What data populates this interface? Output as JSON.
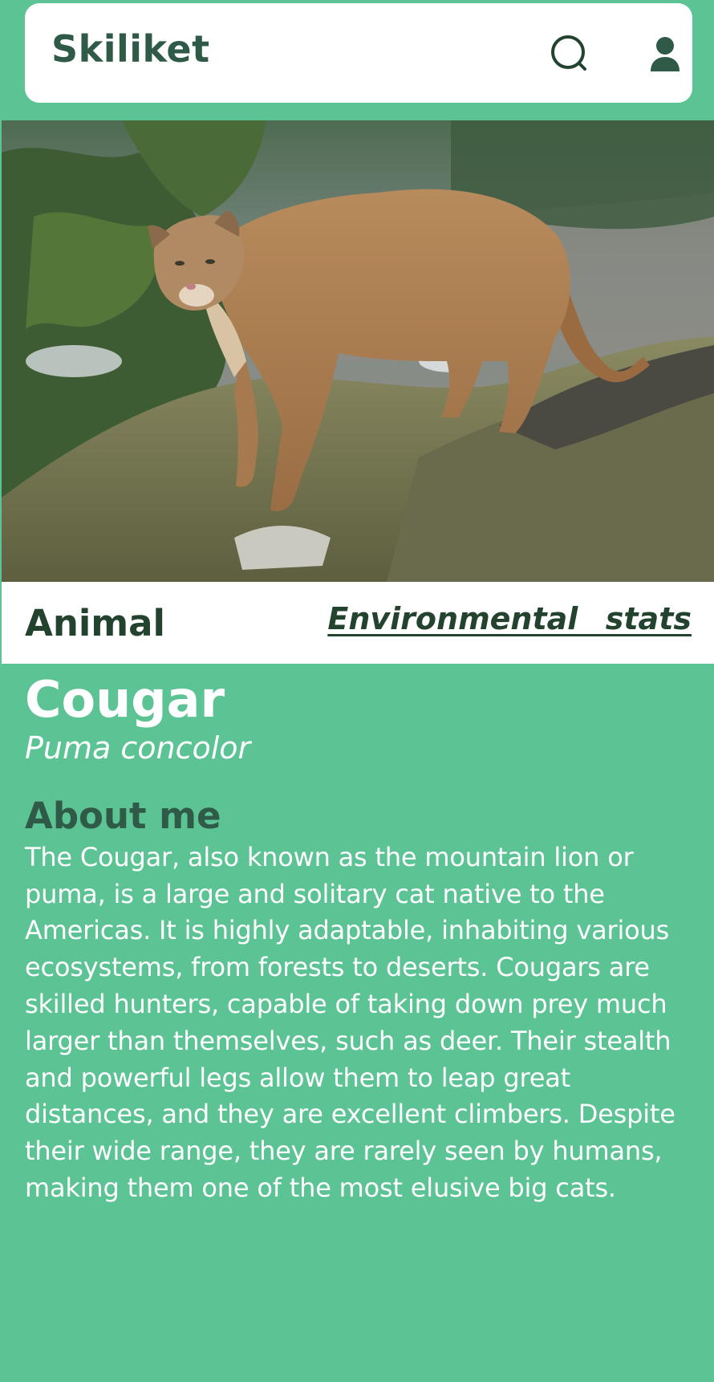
{
  "header": {
    "app_title": "Skiliket",
    "search_icon": "search-icon",
    "user_icon": "user-icon"
  },
  "hero_image": {
    "subject": "cougar-photo"
  },
  "tabs": {
    "animal_label": "Animal",
    "environment_label": "Environmental  stats"
  },
  "animal": {
    "common_name": "Cougar",
    "scientific_name": "Puma concolor",
    "about_title": "About me",
    "about_text": "The Cougar, also known as the mountain lion or puma, is a large and solitary cat native to the Americas. It is highly adaptable, inhabiting various ecosystems, from forests to deserts. Cougars are skilled hunters, capable of taking down prey much larger than themselves, such as deer. Their stealth and powerful legs allow them to leap great distances, and they are excellent climbers. Despite their wide range, they are rarely seen by humans, making them one of the most elusive big cats."
  },
  "colors": {
    "background": "#5cc394",
    "brand_dark": "#2f5a48",
    "tab_text": "#24432f",
    "white": "#ffffff"
  }
}
